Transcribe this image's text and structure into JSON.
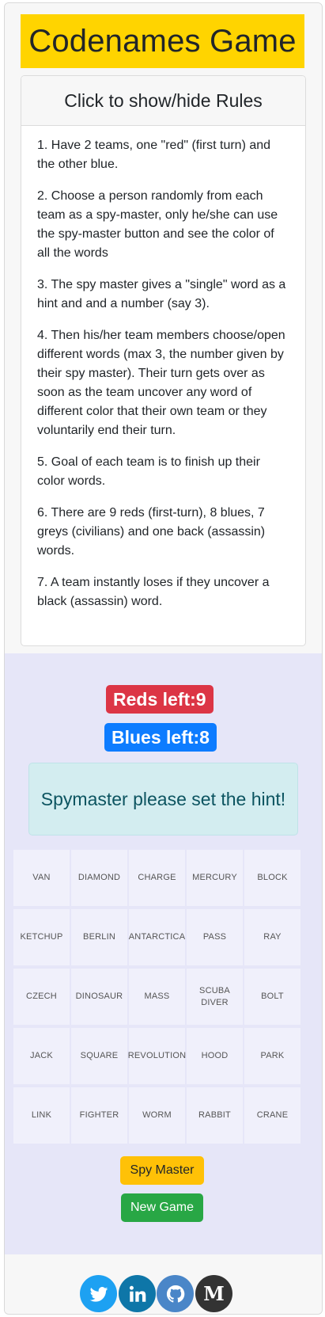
{
  "app": {
    "title": "Codenames Game"
  },
  "rules": {
    "toggle_label": "Click to show/hide Rules",
    "items": [
      "1. Have 2 teams, one \"red\" (first turn) and the other blue.",
      "2. Choose a person randomly from each team as a spy-master, only he/she can use the spy-master button and see the color of all the words",
      "3. The spy master gives a \"single\" word as a hint and and a number (say 3).",
      "4. Then his/her team members choose/open different words (max 3, the number given by their spy master). Their turn gets over as soon as the team uncover any word of different color that their own team or they voluntarily end their turn.",
      "5. Goal of each team is to finish up their color words.",
      "6. There are 9 reds (first-turn), 8 blues, 7 greys (civilians) and one back (assassin) words.",
      "7. A team instantly loses if they uncover a black (assassin) word."
    ]
  },
  "status": {
    "reds_left": "Reds left:9",
    "blues_left": "Blues left:8",
    "hint_message": "Spymaster please set the hint!"
  },
  "board": {
    "words": [
      "VAN",
      "DIAMOND",
      "CHARGE",
      "MERCURY",
      "BLOCK",
      "KETCHUP",
      "BERLIN",
      "ANTARCTICA",
      "PASS",
      "RAY",
      "CZECH",
      "DINOSAUR",
      "MASS",
      "SCUBA DIVER",
      "BOLT",
      "JACK",
      "SQUARE",
      "REVOLUTION",
      "HOOD",
      "PARK",
      "LINK",
      "FIGHTER",
      "WORM",
      "RABBIT",
      "CRANE"
    ]
  },
  "buttons": {
    "spy_master": "Spy Master",
    "new_game": "New Game"
  },
  "footer": {
    "icons": [
      "twitter-icon",
      "linkedin-icon",
      "github-icon",
      "medium-icon"
    ]
  },
  "colors": {
    "title_bg": "#ffd400",
    "red": "#dc3545",
    "blue": "#0d7cff",
    "hint_bg": "#d3edf0",
    "spy_button": "#ffc107",
    "new_game_button": "#28a745",
    "board_bg": "#e6e6f8"
  }
}
